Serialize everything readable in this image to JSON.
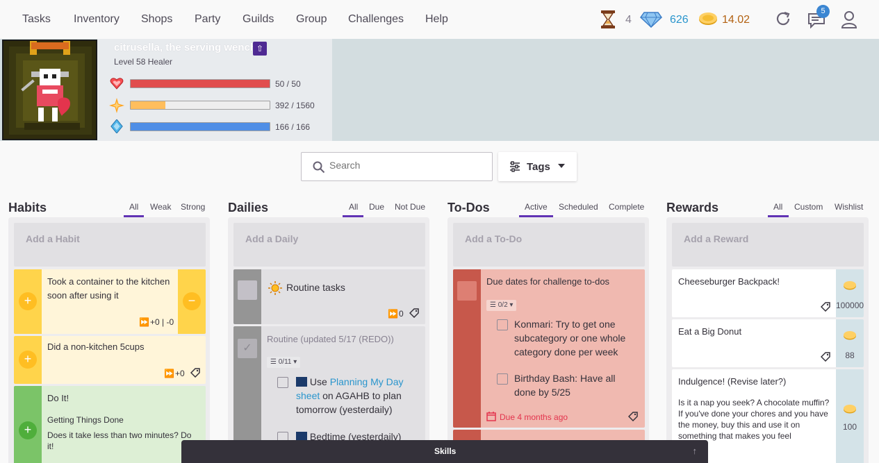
{
  "nav": {
    "items": [
      "Tasks",
      "Inventory",
      "Shops",
      "Party",
      "Guilds",
      "Group",
      "Challenges",
      "Help"
    ],
    "hourglass_count": "4",
    "gems": "626",
    "gold": "14.02",
    "notification_count": "5"
  },
  "profile": {
    "name": "citrusella, the serving wench",
    "level": "Level 58 Healer",
    "hp": {
      "text": "50 / 50",
      "fraction": 1.0,
      "color": "#e14e4e"
    },
    "xp": {
      "text": "392 / 1560",
      "fraction": 0.251,
      "color": "#ffbe5d"
    },
    "mp": {
      "text": "166 / 166",
      "fraction": 1.0,
      "color": "#4f8ee6"
    }
  },
  "search": {
    "placeholder": "Search",
    "tags_label": "Tags"
  },
  "columns": {
    "habits": {
      "title": "Habits",
      "filters": [
        "All",
        "Weak",
        "Strong"
      ],
      "add": "Add a Habit"
    },
    "dailies": {
      "title": "Dailies",
      "filters": [
        "All",
        "Due",
        "Not Due"
      ],
      "add": "Add a Daily"
    },
    "todos": {
      "title": "To-Dos",
      "filters": [
        "Active",
        "Scheduled",
        "Complete"
      ],
      "add": "Add a To-Do"
    },
    "rewards": {
      "title": "Rewards",
      "filters": [
        "All",
        "Custom",
        "Wishlist"
      ],
      "add": "Add a Reward"
    }
  },
  "habits": [
    {
      "text": "Took a container to the kitchen soon after using it",
      "meta": "+0 | -0"
    },
    {
      "text": "Did a non-kitchen 5cups",
      "meta": "+0"
    },
    {
      "text": "Do It!",
      "subtitle": "Getting Things Done",
      "notes": "Does it take less than two minutes? Do it!"
    }
  ],
  "dailies": [
    {
      "text": "Routine tasks",
      "meta": "0"
    },
    {
      "text": "Routine (updated 5/17 (REDO))",
      "checklist": "0/11",
      "items": [
        {
          "pre": "Use ",
          "link": "Planning My Day sheet",
          "post": " on AGAHB to plan tomorrow (yesterdaily)"
        },
        {
          "pre": "Bedtime (yesterdaily)",
          "link": "",
          "post": ""
        }
      ]
    }
  ],
  "todos": [
    {
      "text": "Due dates for challenge to-dos",
      "checklist": "0/2",
      "items": [
        "Konmari: Try to get one subcategory or one whole category done per week",
        "Birthday Bash: Have all done by 5/25"
      ],
      "due": "Due 4 months ago"
    }
  ],
  "rewards": [
    {
      "text": "Cheeseburger Backpack!",
      "price": "100000"
    },
    {
      "text": "Eat a Big Donut",
      "price": "88"
    },
    {
      "text": "Indulgence! (Revise later?)",
      "notes": "Is it a nap you seek? A chocolate muffin? If you've done your chores and you have the money, buy this and use it on something that makes you feel",
      "price": "100"
    }
  ],
  "skills": {
    "label": "Skills"
  }
}
